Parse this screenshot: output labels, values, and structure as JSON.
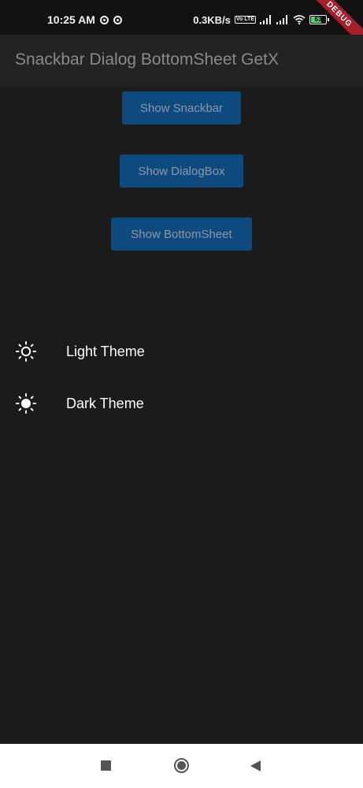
{
  "status_bar": {
    "time": "10:25 AM",
    "network_speed": "0.3KB/s",
    "volte_badge": "Vo LTE",
    "battery_level": "63",
    "icons": [
      "sync-ring-icon",
      "sync-ring-icon",
      "signal-icon",
      "signal-icon",
      "wifi-icon",
      "battery-icon"
    ]
  },
  "debug_banner": "DEBUG",
  "app_bar": {
    "title": "Snackbar Dialog BottomSheet GetX"
  },
  "buttons": {
    "snackbar": "Show Snackbar",
    "dialog": "Show DialogBox",
    "bottomsheet": "Show BottomSheet"
  },
  "theme_options": [
    {
      "label": "Light Theme",
      "icon": "sun-outline-icon"
    },
    {
      "label": "Dark Theme",
      "icon": "sun-filled-icon"
    }
  ],
  "nav_bar": {
    "icons": [
      "recents-square-icon",
      "home-circle-icon",
      "back-triangle-icon"
    ]
  },
  "colors": {
    "background": "#1b1b1b",
    "app_bar": "#232323",
    "button": "#0e4a7d",
    "debug": "#a6202b"
  }
}
